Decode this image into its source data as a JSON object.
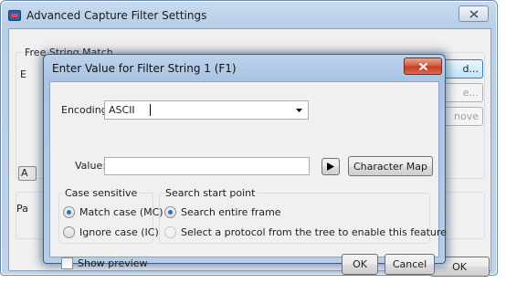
{
  "outer_window": {
    "title": "Advanced Capture Filter Settings",
    "group_title": "Free String Match",
    "side_buttons": [
      "d...",
      "e...",
      "nove"
    ],
    "left_fragments": [
      "E",
      "A",
      "Pa"
    ],
    "ok_label": "OK"
  },
  "dialog": {
    "title": "Enter Value for Filter String 1 (F1)",
    "encoding": {
      "label": "Encoding:",
      "value": "ASCII"
    },
    "value": {
      "label": "Value:",
      "text": ""
    },
    "play_button_icon": "play-arrow-icon",
    "character_map_label": "Character Map",
    "case_sensitive": {
      "title": "Case sensitive",
      "options": [
        "Match case (MC)",
        "Ignore case (IC)"
      ],
      "selected": 0
    },
    "search_start": {
      "title": "Search start point",
      "options": [
        "Search entire frame",
        "Select a protocol from the tree to enable this feature"
      ],
      "selected": 0
    },
    "show_preview": {
      "label": "Show preview",
      "checked": false
    },
    "ok_label": "OK",
    "cancel_label": "Cancel"
  },
  "colors": {
    "accent": "#2a70c6",
    "close_red": "#c23a22"
  }
}
